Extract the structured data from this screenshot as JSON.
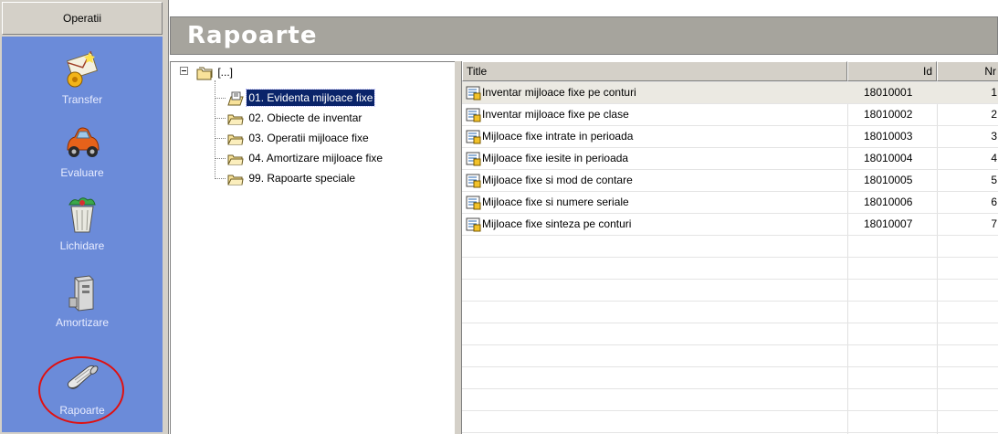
{
  "sidebar": {
    "header": "Operatii",
    "items": [
      {
        "label": "Transfer",
        "icon": "transfer-envelope-icon"
      },
      {
        "label": "Evaluare",
        "icon": "car-icon"
      },
      {
        "label": "Lichidare",
        "icon": "recycle-bin-icon"
      },
      {
        "label": "Amortizare",
        "icon": "server-icon"
      },
      {
        "label": "Rapoarte",
        "icon": "scroll-report-icon"
      }
    ]
  },
  "title": "Rapoarte",
  "tree": {
    "root": "[...]",
    "items": [
      {
        "label": "01. Evidenta mijloace fixe",
        "selected": true,
        "icon": "open-report-icon"
      },
      {
        "label": "02. Obiecte de inventar",
        "icon": "folder-icon"
      },
      {
        "label": "03. Operatii mijloace fixe",
        "icon": "folder-icon"
      },
      {
        "label": "04. Amortizare mijloace fixe",
        "icon": "folder-icon"
      },
      {
        "label": "99. Rapoarte speciale",
        "icon": "folder-icon"
      }
    ]
  },
  "list": {
    "columns": [
      "Title",
      "Id",
      "Nr"
    ],
    "rows": [
      {
        "title": "Inventar mijloace fixe pe conturi",
        "id": "18010001",
        "nr": "1"
      },
      {
        "title": "Inventar mijloace fixe pe clase",
        "id": "18010002",
        "nr": "2"
      },
      {
        "title": "Mijloace fixe intrate in perioada",
        "id": "18010003",
        "nr": "3"
      },
      {
        "title": "Mijloace fixe iesite in perioada",
        "id": "18010004",
        "nr": "4"
      },
      {
        "title": "Mijloace fixe si mod de contare",
        "id": "18010005",
        "nr": "5"
      },
      {
        "title": "Mijloace fixe si numere seriale",
        "id": "18010006",
        "nr": "6"
      },
      {
        "title": "Mijloace fixe sinteza pe conturi",
        "id": "18010007",
        "nr": "7"
      }
    ]
  },
  "colors": {
    "sidebar_panel": "#6b8bd9",
    "titlebar": "#a6a49d",
    "highlight_ring": "#e01010",
    "selection": "#0a246a"
  }
}
